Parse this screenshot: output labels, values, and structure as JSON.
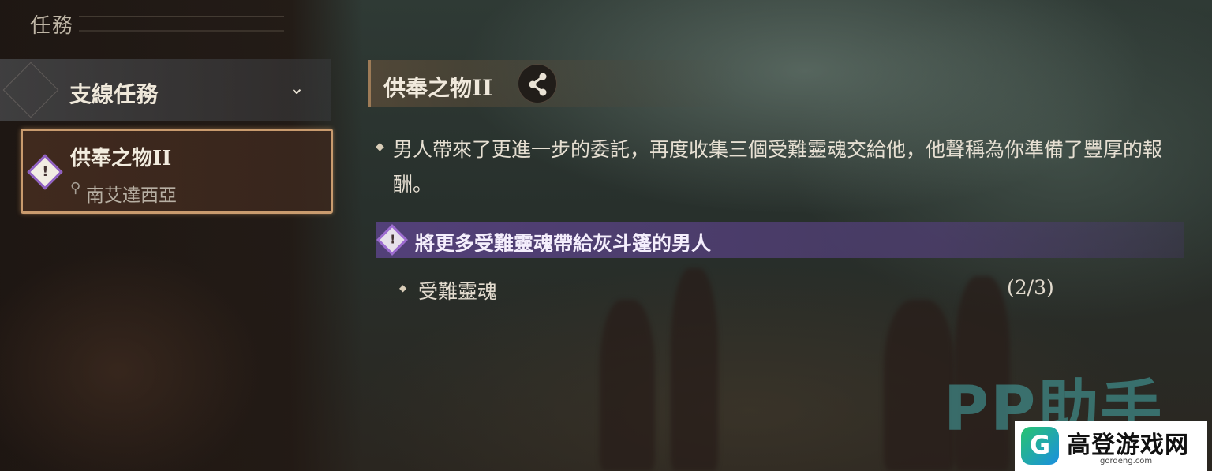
{
  "panel": {
    "title": "任務"
  },
  "category": {
    "label": "支線任務",
    "chevron_icon": "chevron-down-icon"
  },
  "quest_list": [
    {
      "name": "供奉之物II",
      "location": "南艾達西亞",
      "status_icon": "quest-alert-icon",
      "location_icon": "map-pin-icon"
    }
  ],
  "detail": {
    "title": "供奉之物II",
    "share_icon": "share-icon",
    "description": "男人帶來了更進一步的委託，再度收集三個受難靈魂交給他，他聲稱為你準備了豐厚的報酬。",
    "objective": {
      "text": "將更多受難靈魂帶給灰斗篷的男人",
      "subtasks": [
        {
          "label": "受難靈魂",
          "count": "(2/3)"
        }
      ]
    }
  },
  "watermark": {
    "pp": "PP助手",
    "site_cn": "高登游戏网",
    "site_url": "gordeng.com",
    "logo_letter": "G"
  },
  "colors": {
    "accent_purple": "#5a4382",
    "card_border": "#c99b6e",
    "text_light": "#e8e0d0"
  }
}
